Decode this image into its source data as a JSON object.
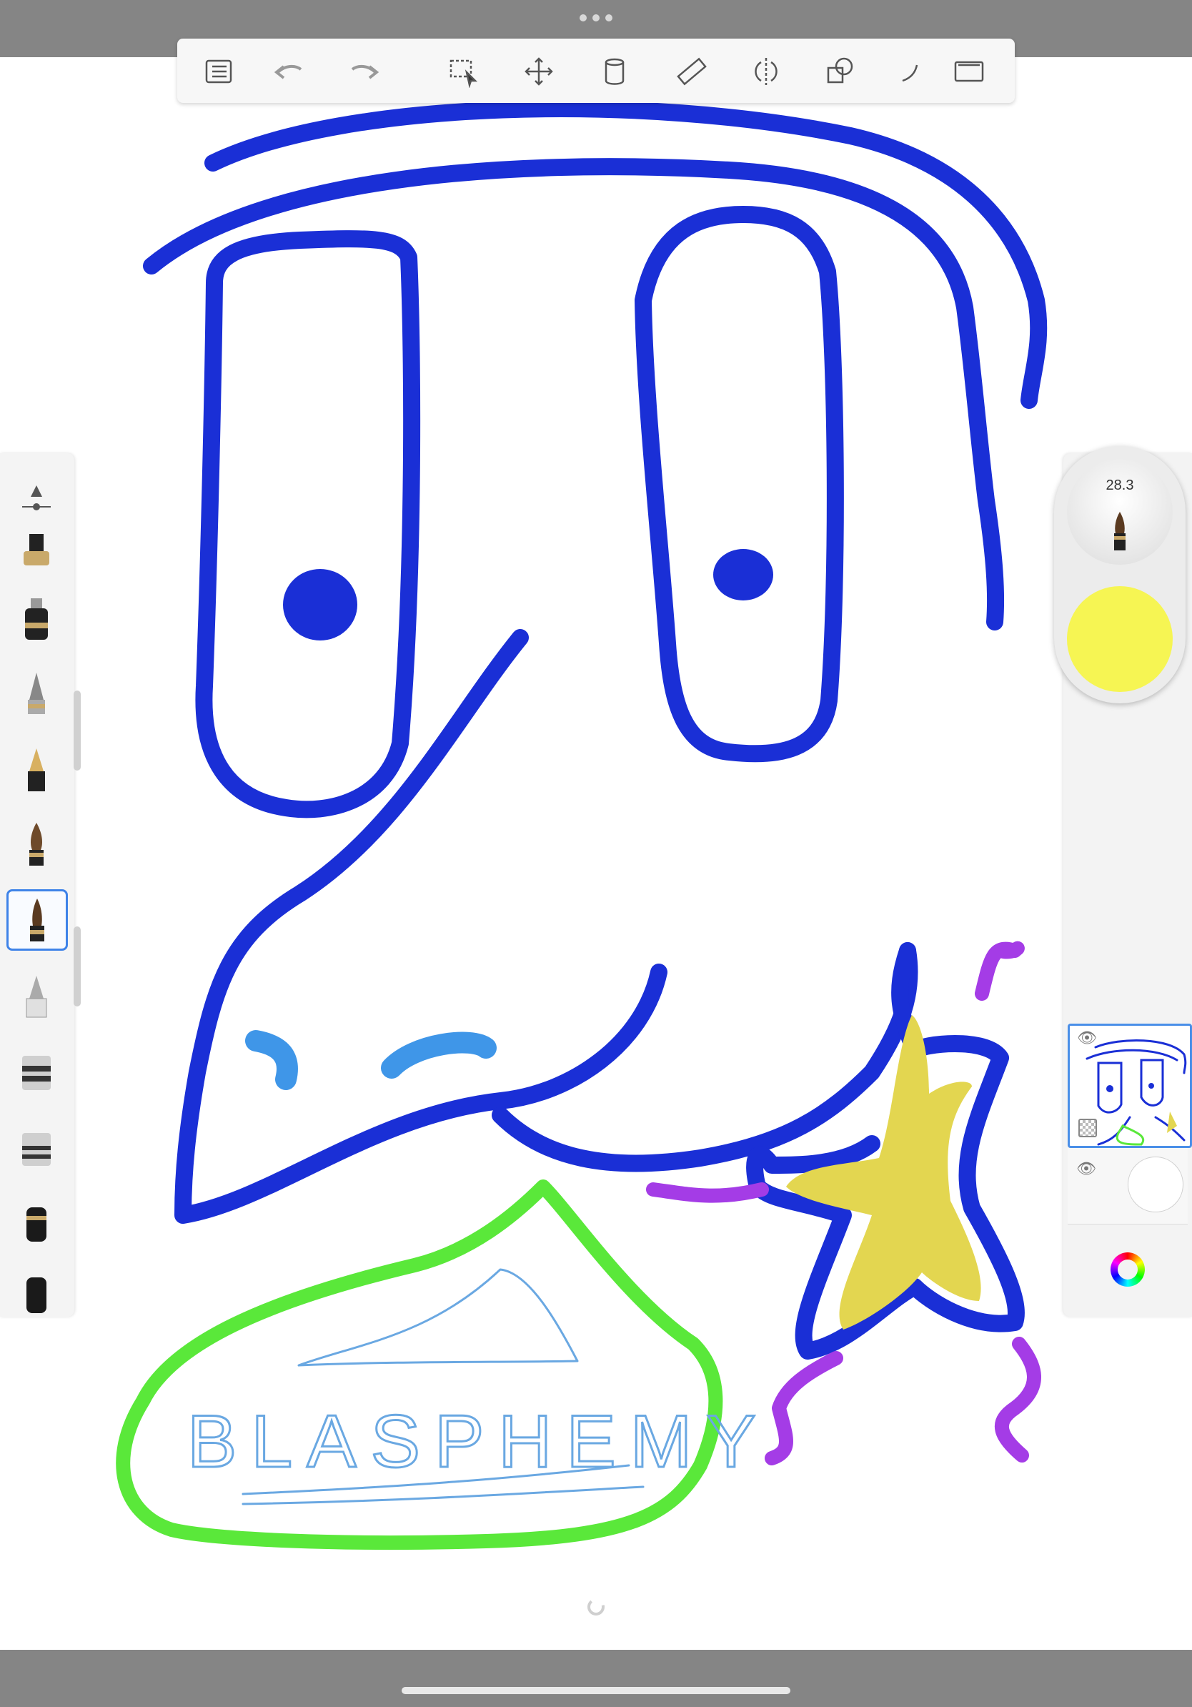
{
  "app": {
    "accent": "#3f83e8",
    "chrome": "#858585"
  },
  "toolbar": {
    "buttons": [
      {
        "name": "list-icon"
      },
      {
        "name": "undo-icon"
      },
      {
        "name": "redo-icon"
      },
      {
        "name": "selection-icon"
      },
      {
        "name": "transform-icon"
      },
      {
        "name": "fill-icon"
      },
      {
        "name": "ruler-icon"
      },
      {
        "name": "symmetry-icon"
      },
      {
        "name": "shapes-icon"
      },
      {
        "name": "curve-icon"
      },
      {
        "name": "fullscreen-icon"
      }
    ]
  },
  "brush": {
    "size": "28.3",
    "current_color": "#f6f553"
  },
  "brush_library": [
    "brush-size-slider-icon",
    "ink-pen-icon",
    "technical-pen-icon",
    "pencil-icon",
    "fountain-pen-icon",
    "paintbrush-icon",
    "ink-brush-icon",
    "chisel-marker-icon",
    "marker-icon",
    "airbrush-icon",
    "eraser-icon",
    "smudge-icon"
  ],
  "drawing": {
    "text": "BLASPHEMY",
    "colors": {
      "blue": "#1a2fd6",
      "light_blue": "#3f96e8",
      "green": "#5ae83a",
      "purple": "#a43ce6",
      "yellow": "#e3d650",
      "sketch_blue": "#6aa8e2"
    }
  },
  "layers": [
    {
      "selected": true,
      "visible": true
    },
    {
      "selected": false,
      "visible": true
    }
  ]
}
